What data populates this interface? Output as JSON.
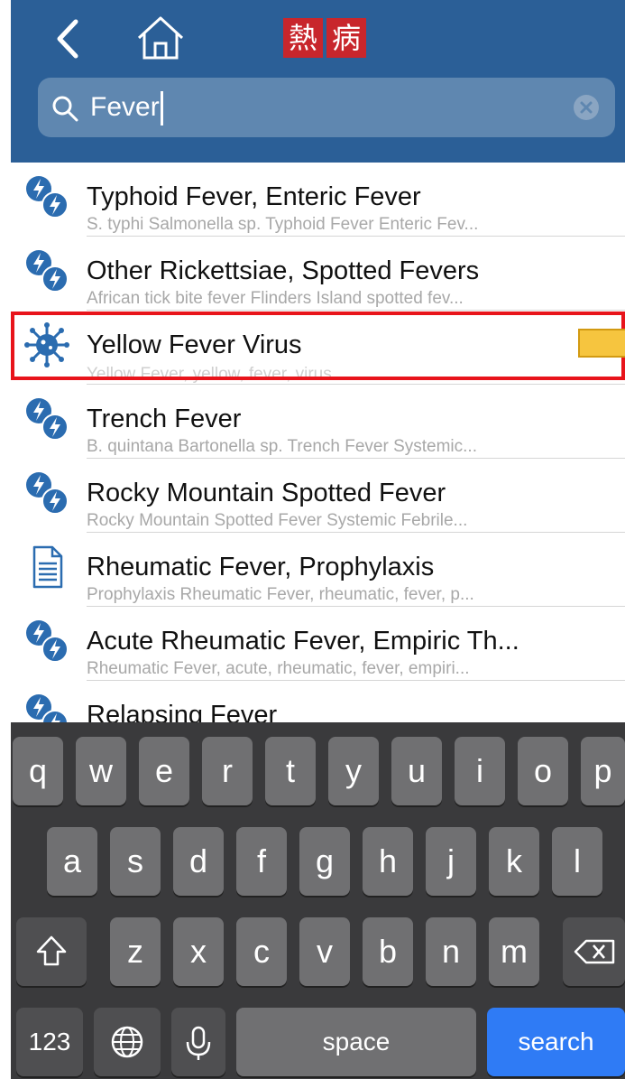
{
  "header": {
    "logo_chars": [
      "熱",
      "病"
    ]
  },
  "search": {
    "value": "Fever",
    "placeholder": ""
  },
  "results": [
    {
      "title": "Typhoid Fever, Enteric Fever",
      "subtitle": "S. typhi Salmonella sp. Typhoid Fever Enteric Fev...",
      "icon": "bolt-pair-icon"
    },
    {
      "title": "Other Rickettsiae, Spotted Fevers",
      "subtitle": "African tick bite fever Flinders Island spotted fev...",
      "icon": "bolt-pair-icon"
    },
    {
      "title": "Yellow Fever Virus",
      "subtitle": "Yellow Fever, yellow, fever, virus",
      "icon": "virus-icon"
    },
    {
      "title": "Trench Fever",
      "subtitle": "B. quintana Bartonella sp. Trench Fever Systemic...",
      "icon": "bolt-pair-icon"
    },
    {
      "title": "Rocky Mountain Spotted Fever",
      "subtitle": "Rocky Mountain Spotted Fever Systemic Febrile...",
      "icon": "bolt-pair-icon"
    },
    {
      "title": "Rheumatic Fever, Prophylaxis",
      "subtitle": "Prophylaxis Rheumatic Fever, rheumatic, fever, p...",
      "icon": "document-icon"
    },
    {
      "title": "Acute Rheumatic Fever, Empiric Th...",
      "subtitle": "Rheumatic Fever, acute, rheumatic, fever, empiri...",
      "icon": "bolt-pair-icon"
    },
    {
      "title": "Relapsing Fever",
      "subtitle": "",
      "icon": "bolt-pair-icon"
    }
  ],
  "keyboard": {
    "row1": [
      "q",
      "w",
      "e",
      "r",
      "t",
      "y",
      "u",
      "i",
      "o",
      "p"
    ],
    "row2": [
      "a",
      "s",
      "d",
      "f",
      "g",
      "h",
      "j",
      "k",
      "l"
    ],
    "row3": [
      "z",
      "x",
      "c",
      "v",
      "b",
      "n",
      "m"
    ],
    "numbers_label": "123",
    "space_label": "space",
    "search_label": "search"
  },
  "colors": {
    "header": "#2b5f97",
    "accent_blue": "#2f7bf5",
    "highlight": "#e8141b",
    "tag": "#f6c53f"
  }
}
